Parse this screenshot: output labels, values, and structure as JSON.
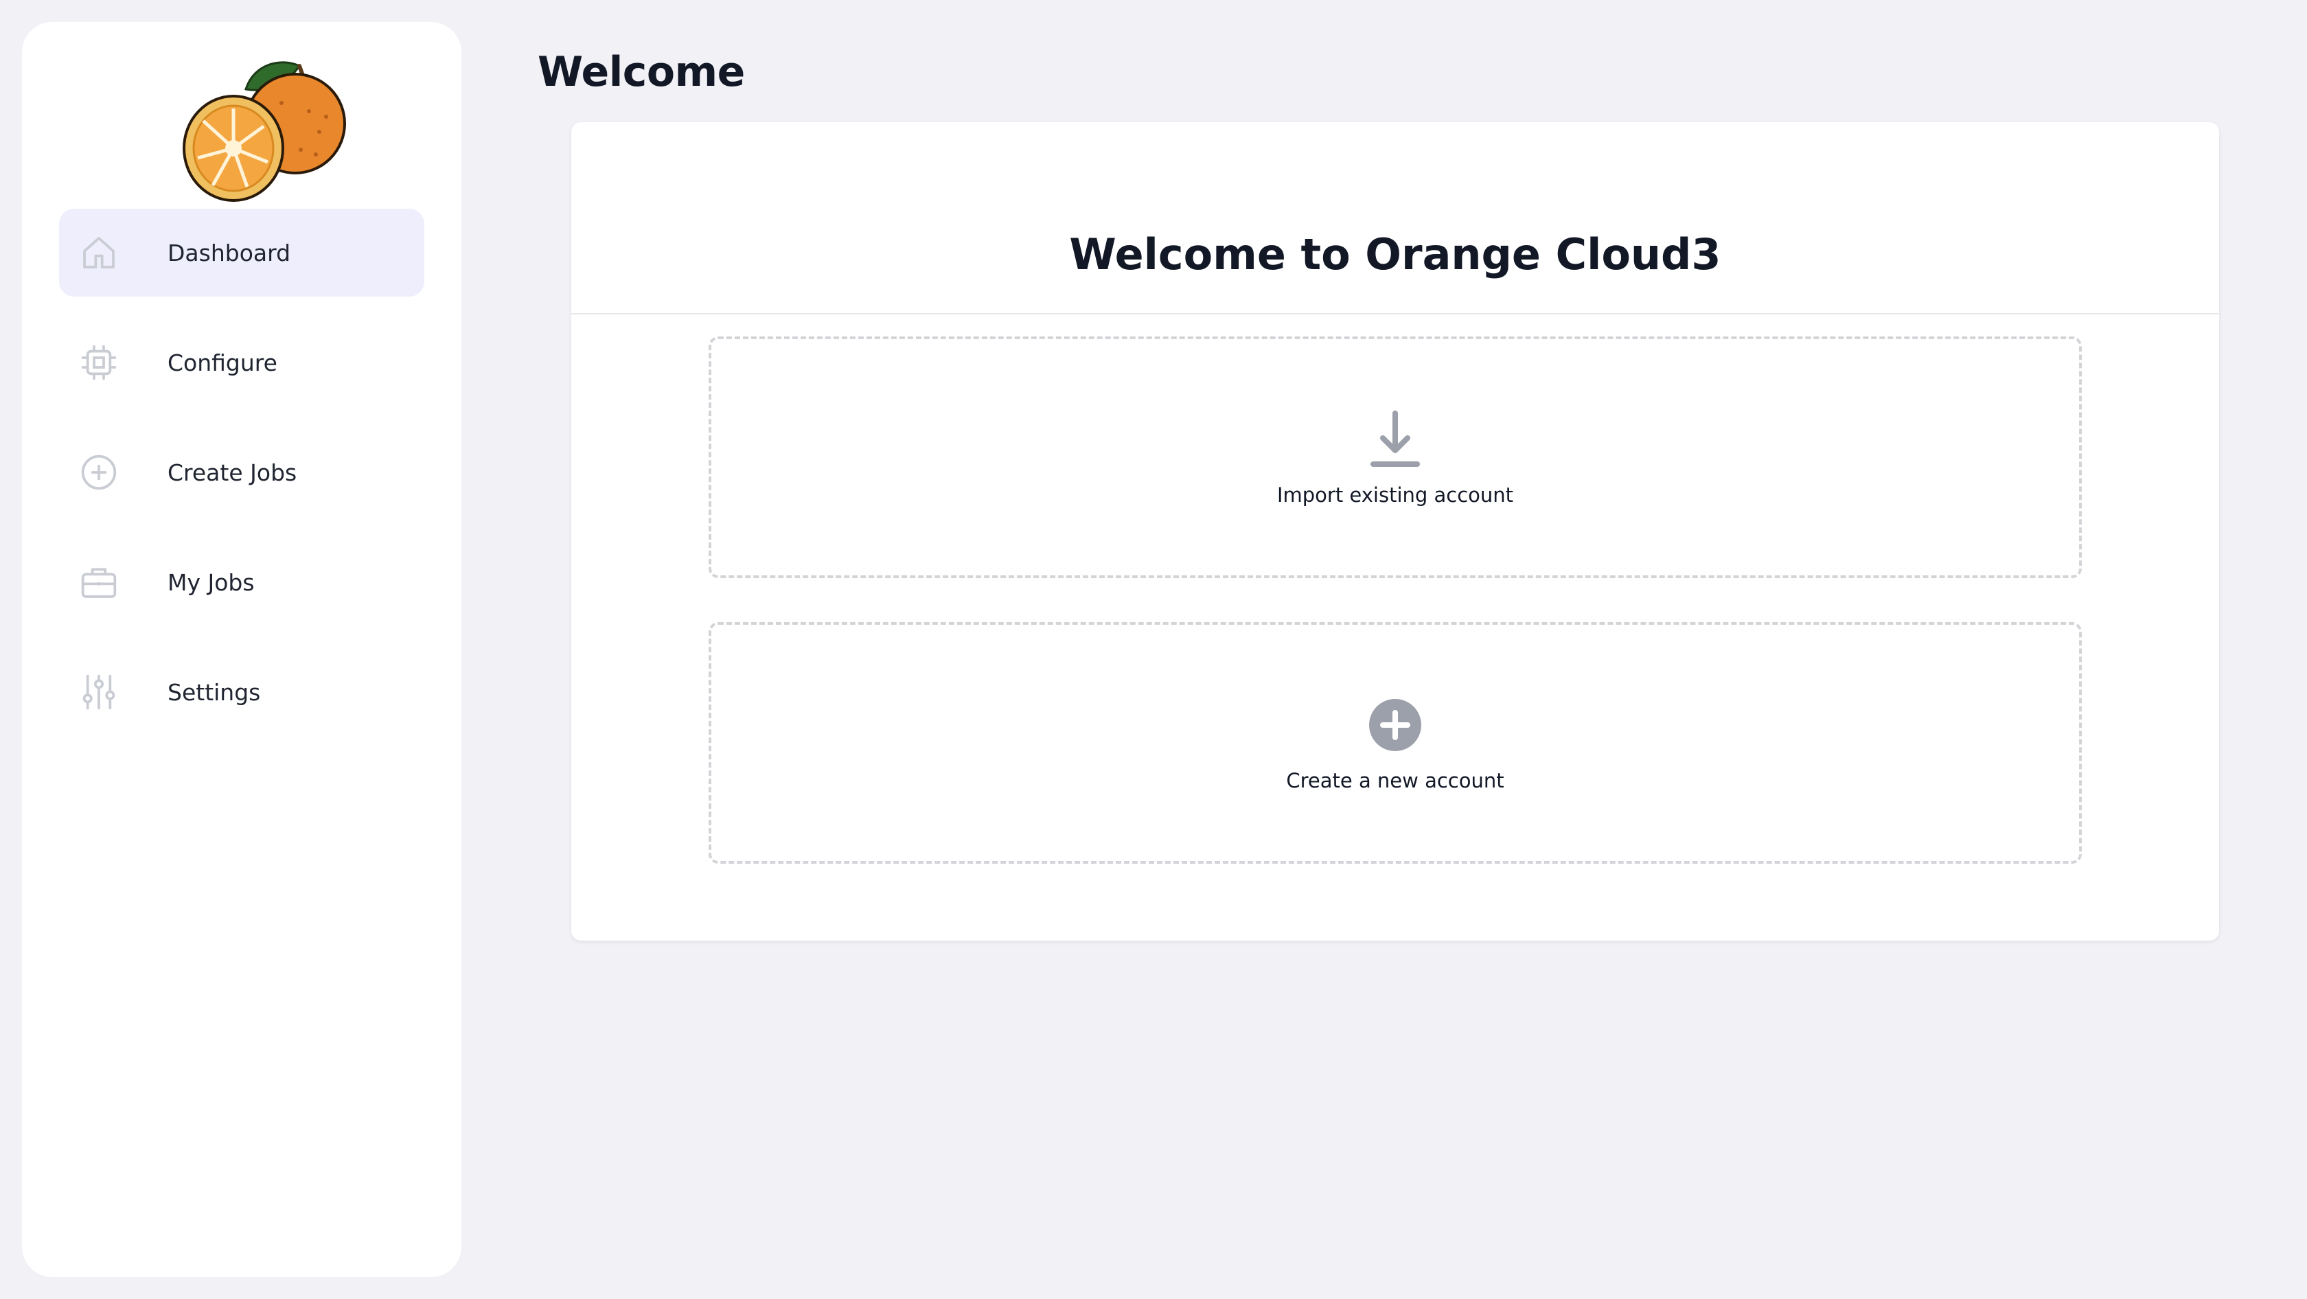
{
  "sidebar": {
    "logo": "orange-fruit-logo",
    "items": [
      {
        "label": "Dashboard",
        "icon": "home-icon",
        "active": true
      },
      {
        "label": "Configure",
        "icon": "cpu-chip-icon",
        "active": false
      },
      {
        "label": "Create Jobs",
        "icon": "plus-circle-icon",
        "active": false
      },
      {
        "label": "My Jobs",
        "icon": "briefcase-icon",
        "active": false
      },
      {
        "label": "Settings",
        "icon": "sliders-icon",
        "active": false
      }
    ]
  },
  "main": {
    "page_title": "Welcome",
    "card": {
      "title": "Welcome to Orange Cloud3",
      "options": [
        {
          "label": "Import existing account",
          "icon": "download-icon"
        },
        {
          "label": "Create a new account",
          "icon": "plus-circle-filled-icon"
        }
      ]
    }
  },
  "colors": {
    "background": "#f1f1f6",
    "active_nav": "#eeeefc",
    "icon_gray": "#9ca0aa",
    "text_dark": "#121826"
  }
}
